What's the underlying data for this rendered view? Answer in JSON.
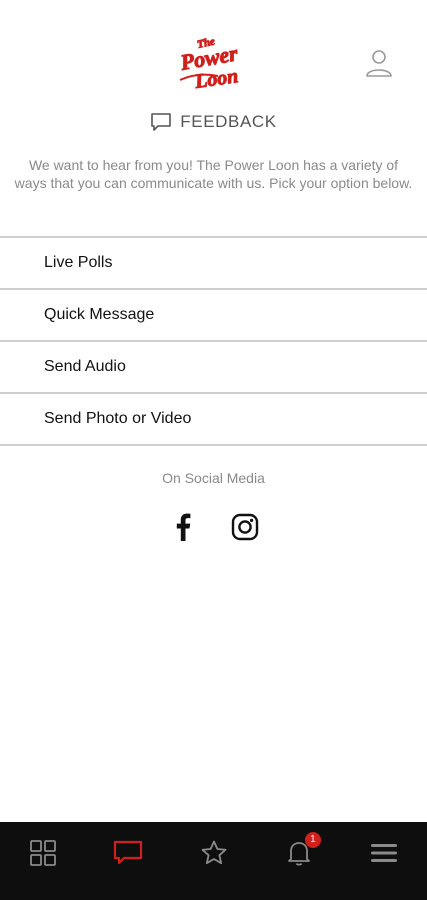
{
  "brand": {
    "logo_text": "The Power Loon",
    "accent_color": "#d0201c"
  },
  "header": {
    "profile_icon": "user-icon"
  },
  "feedback": {
    "icon": "chat-icon",
    "title": "FEEDBACK",
    "intro": "We want to hear from you! The Power Loon has a variety of ways that you can communicate with us. Pick your option below."
  },
  "options": [
    {
      "label": "Live Polls"
    },
    {
      "label": "Quick Message"
    },
    {
      "label": "Send Audio"
    },
    {
      "label": "Send Photo or Video"
    }
  ],
  "social": {
    "label": "On Social Media",
    "networks": [
      "facebook-icon",
      "instagram-icon"
    ]
  },
  "tabbar": {
    "background": "#0e0e0e",
    "active_color": "#d0201c",
    "tabs": [
      {
        "icon": "grid-icon",
        "active": false
      },
      {
        "icon": "chat-icon",
        "active": true
      },
      {
        "icon": "star-icon",
        "active": false
      },
      {
        "icon": "bell-icon",
        "active": false,
        "badge": "1"
      },
      {
        "icon": "menu-icon",
        "active": false
      }
    ]
  }
}
